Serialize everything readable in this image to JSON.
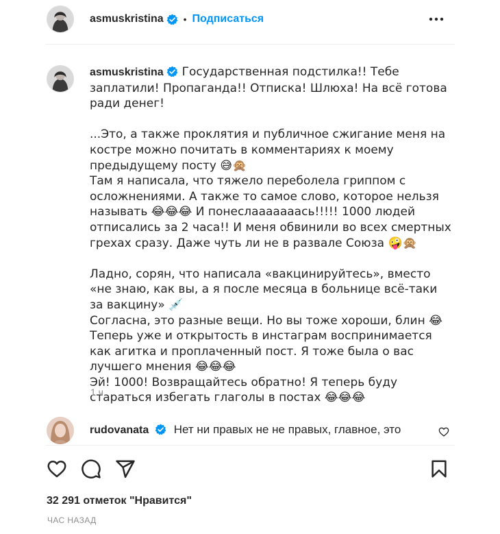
{
  "post": {
    "author": "asmuskristina",
    "follow_label": "Подписаться",
    "separator": "•"
  },
  "caption": {
    "author": "asmuskristina",
    "text": "Государственная подстилка!! Тебе заплатили! Пропаганда!! Отписка! Шлюха! На всё готова ради денег!\n\n...Это, а также проклятия и публичное сжигание меня на костре можно почитать в комментариях к моему предыдущему посту 😅🙊\nТам я написала, что тяжело переболела гриппом с осложнениями. А также то самое слово, которое нельзя называть 😂😂😂 И понеслааааааась!!!!! 1000 людей отписались за 2 часа!! И меня обвинили во всех смертных грехах сразу. Даже чуть ли не в развале Союза 🤪🙊\n\nЛадно, сорян, что написала «вакцинируйтесь», вместо «не знаю, как вы, а я после месяца в больнице всё-таки за вакцину» 💉\nСогласна, это разные вещи. Но вы тоже хороши, блин 😂\nТеперь уже и открытость в инстаграм воспринимается как агитка и проплаченный пост. Я тоже была о вас лучшего мнения 😂😂😂\nЭй! 1000! Возвращайтесь обратно! Я теперь буду стараться избегать глаголы в постах 😂😂😂",
    "time": "1 ч."
  },
  "comment": {
    "author": "rudovanata",
    "text": "Нет ни правых не не правых, главное, это"
  },
  "stats": {
    "likes": "32 291 отметок \"Нравится\"",
    "ago": "ЧАС НАЗАД"
  },
  "icons": {
    "more": "more-horizontal-icon",
    "verified": "verified-badge-icon",
    "like": "heart-icon",
    "comment": "comment-bubble-icon",
    "share": "paper-plane-icon",
    "save": "bookmark-icon"
  },
  "colors": {
    "link": "#0095f6",
    "text": "#262626",
    "muted": "#8e8e8e",
    "verified": "#0095f6"
  }
}
